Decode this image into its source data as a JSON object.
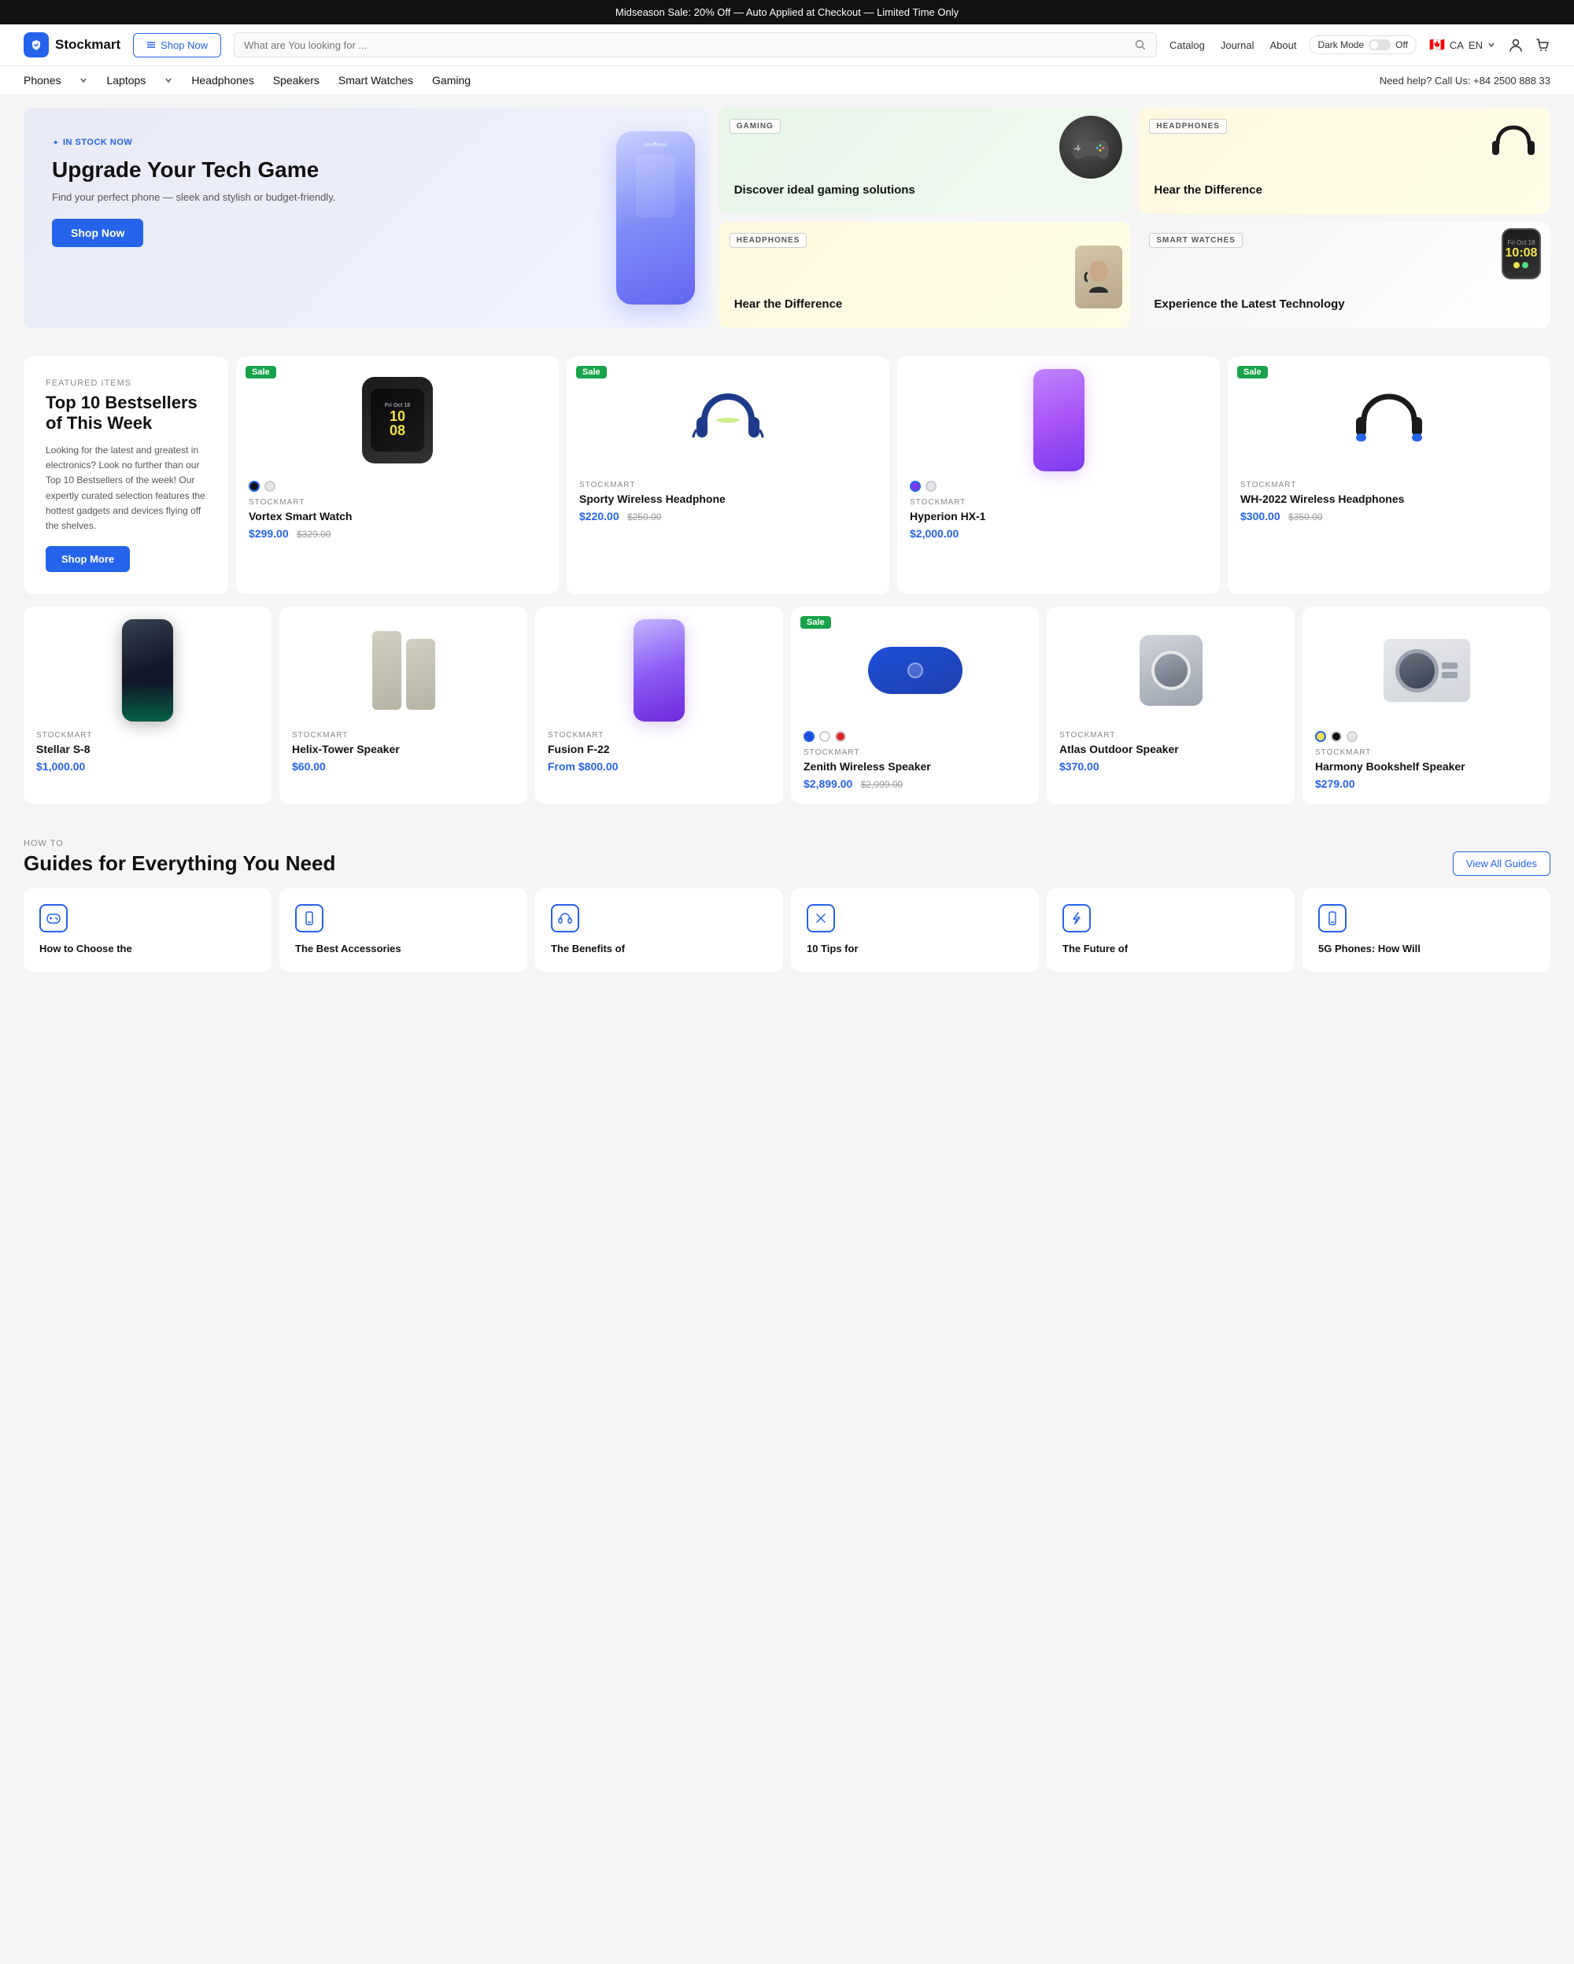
{
  "topBanner": {
    "text": "Midseason Sale: 20% Off — Auto Applied at Checkout — Limited Time Only"
  },
  "header": {
    "logoText": "Stockmart",
    "shopNowLabel": "Shop Now",
    "searchPlaceholder": "What are You looking for ...",
    "navLinks": [
      "Catalog",
      "Journal",
      "About"
    ],
    "darkMode": {
      "label": "Dark Mode",
      "state": "Off"
    },
    "locale": {
      "country": "CA",
      "flag": "🇨🇦",
      "lang": "EN"
    }
  },
  "categoryNav": {
    "items": [
      {
        "label": "Phones",
        "hasDropdown": true
      },
      {
        "label": "Laptops",
        "hasDropdown": true
      },
      {
        "label": "Headphones"
      },
      {
        "label": "Speakers"
      },
      {
        "label": "Smart Watches"
      },
      {
        "label": "Gaming"
      }
    ],
    "helpText": "Need help? Call Us: +84 2500 888 33"
  },
  "hero": {
    "main": {
      "badge": "IN STOCK NOW",
      "title": "Upgrade Your Tech Game",
      "description": "Find your perfect phone — sleek and stylish or budget-friendly.",
      "shopNowLabel": "Shop Now"
    },
    "gaming": {
      "label": "GAMING",
      "title": "Discover ideal gaming solutions"
    },
    "headphones": {
      "label": "HEADPHONES",
      "title": "Hear the Difference"
    },
    "smartwatches": {
      "label": "SMART WATCHES",
      "title": "Experience the Latest Technology",
      "time": "10:08",
      "date": "Fri Oct 18"
    }
  },
  "featuredSection": {
    "label": "FEATURED ITEMS",
    "title": "Top 10 Bestsellers of This Week",
    "description": "Looking for the latest and greatest in electronics? Look no further than our Top 10 Bestsellers of the week! Our expertly curated selection features the hottest gadgets and devices flying off the shelves.",
    "shopMoreLabel": "Shop More"
  },
  "products": [
    {
      "id": "vortex-smartwatch",
      "brand": "STOCKMART",
      "name": "Vortex Smart Watch",
      "price": "$299.00",
      "originalPrice": "$329.00",
      "sale": true,
      "colors": [
        "#111",
        "#e5e7eb"
      ]
    },
    {
      "id": "sporty-headphone",
      "brand": "STOCKMART",
      "name": "Sporty Wireless Headphone",
      "price": "$220.00",
      "originalPrice": "$250.00",
      "sale": true,
      "colors": []
    },
    {
      "id": "hyperion-hx1",
      "brand": "STOCKMART",
      "name": "Hyperion HX-1",
      "price": "$2,000.00",
      "originalPrice": "",
      "sale": false,
      "colors": [
        "#6d28d9",
        "#e5e7eb"
      ]
    },
    {
      "id": "wh-2022",
      "brand": "STOCKMART",
      "name": "WH-2022 Wireless Headphones",
      "price": "$300.00",
      "originalPrice": "$350.00",
      "sale": true,
      "colors": []
    },
    {
      "id": "stellar-s8",
      "brand": "STOCKMART",
      "name": "Stellar S-8",
      "price": "$1,000.00",
      "originalPrice": "",
      "sale": false
    },
    {
      "id": "helix-tower",
      "brand": "STOCKMART",
      "name": "Helix-Tower Speaker",
      "price": "$60.00",
      "originalPrice": "",
      "sale": false
    },
    {
      "id": "fusion-f22",
      "brand": "STOCKMART",
      "name": "Fusion F-22",
      "price": "From $800.00",
      "originalPrice": "",
      "sale": false
    },
    {
      "id": "zenith-speaker",
      "brand": "STOCKMART",
      "name": "Zenith Wireless Speaker",
      "price": "$2,899.00",
      "originalPrice": "$2,999.00",
      "sale": true,
      "colors": [
        "#1d4ed8",
        "#fff",
        "#dc2626"
      ]
    },
    {
      "id": "atlas-speaker",
      "brand": "STOCKMART",
      "name": "Atlas Outdoor Speaker",
      "price": "$370.00",
      "originalPrice": "",
      "sale": false
    },
    {
      "id": "harmony-speaker",
      "brand": "STOCKMART",
      "name": "Harmony Bookshelf Speaker",
      "price": "$279.00",
      "originalPrice": "",
      "sale": false,
      "colors": [
        "#f0e14a",
        "#111",
        "#e5e7eb"
      ]
    }
  ],
  "guides": {
    "label": "HOW TO",
    "title": "Guides for Everything You Need",
    "viewAllLabel": "View All Guides",
    "items": [
      {
        "id": "guide-1",
        "title": "How to Choose the",
        "icon": "gamepad"
      },
      {
        "id": "guide-2",
        "title": "The Best Accessories",
        "icon": "phone"
      },
      {
        "id": "guide-3",
        "title": "The Benefits of",
        "icon": "headphones"
      },
      {
        "id": "guide-4",
        "title": "10 Tips for",
        "icon": "tools"
      },
      {
        "id": "guide-5",
        "title": "The Future of",
        "icon": "lightning"
      },
      {
        "id": "guide-6",
        "title": "5G Phones: How Will",
        "icon": "phone2"
      }
    ]
  }
}
